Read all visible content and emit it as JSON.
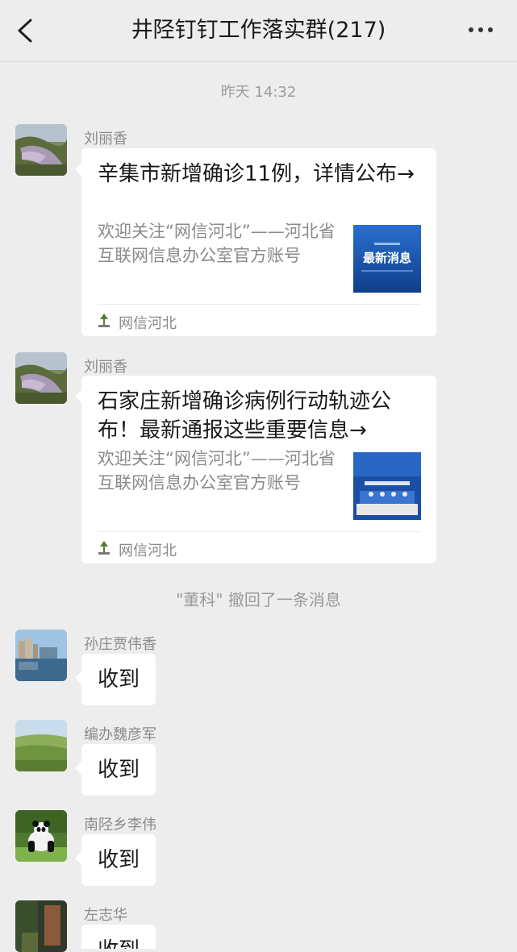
{
  "header": {
    "title": "井陉钉钉工作落实群(217)",
    "back_icon": "chevron-left-icon",
    "more_icon": "more-dots-icon"
  },
  "timestamp": "昨天 14:32",
  "messages": [
    {
      "sender": "刘丽香",
      "card": {
        "title": "辛集市新增确诊11例，详情公布→",
        "desc": "欢迎关注“网信河北”——河北省互联网信息办公室官方账号",
        "thumb_text": "最新消息",
        "source": "网信河北"
      }
    },
    {
      "sender": "刘丽香",
      "card": {
        "title": "石家庄新增确诊病例行动轨迹公布！最新通报这些重要信息→",
        "desc": "欢迎关注“网信河北”——河北省互联网信息办公室官方账号",
        "source": "网信河北"
      }
    }
  ],
  "recall_notice": "\"董科\" 撤回了一条消息",
  "replies": [
    {
      "sender": "孙庄贾伟香",
      "text": "收到"
    },
    {
      "sender": "编办魏彦军",
      "text": "收到"
    },
    {
      "sender": "南陉乡李伟",
      "text": "收到"
    },
    {
      "sender": "左志华",
      "text": "收到"
    }
  ],
  "colors": {
    "background": "#ededed",
    "bubble": "#ffffff",
    "thumb_blue": "#1d5fb8"
  }
}
